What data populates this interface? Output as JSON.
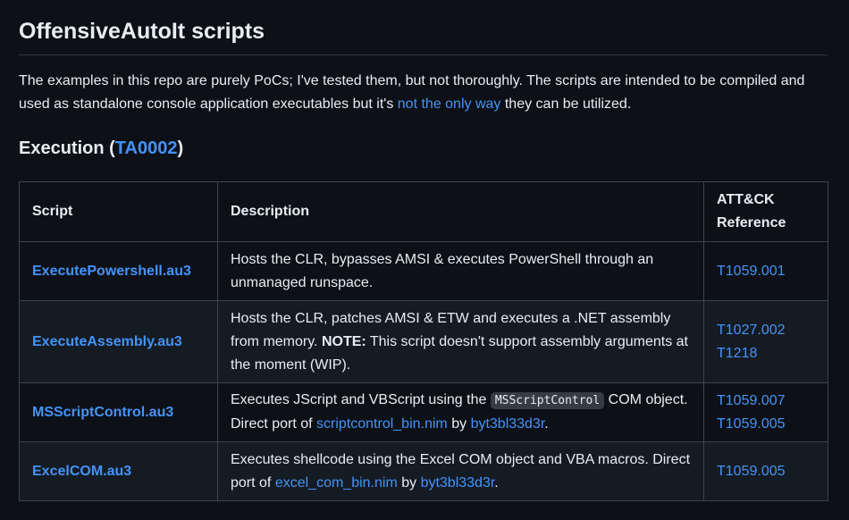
{
  "header": {
    "title": "OffensiveAutoIt scripts"
  },
  "intro": {
    "text_before": "The examples in this repo are purely PoCs; I've tested them, but not thoroughly. The scripts are intended to be compiled and used as standalone console application executables but it's ",
    "link": "not the only way",
    "text_after": " they can be utilized."
  },
  "section": {
    "title_prefix": "Execution (",
    "tactic_link": "TA0002",
    "title_suffix": ")"
  },
  "table": {
    "headers": [
      "Script",
      "Description",
      "ATT&CK Reference"
    ],
    "rows": [
      {
        "script": "ExecutePowershell.au3",
        "desc": {
          "text": "Hosts the CLR, bypasses AMSI & executes PowerShell through an unmanaged runspace."
        },
        "refs": [
          "T1059.001"
        ]
      },
      {
        "script": "ExecuteAssembly.au3",
        "desc": {
          "text_before": "Hosts the CLR, patches AMSI & ETW and executes a .NET assembly from memory. ",
          "bold": "NOTE:",
          "text_after": " This script doesn't support assembly arguments at the moment (WIP)."
        },
        "refs": [
          "T1027.002",
          "T1218"
        ]
      },
      {
        "script": "MSScriptControl.au3",
        "desc": {
          "text_before": "Executes JScript and VBScript using the ",
          "code": "MSScriptControl",
          "text_mid": " COM object. Direct port of ",
          "link1": "scriptcontrol_bin.nim",
          "by": " by ",
          "link2": "byt3bl33d3r",
          "end": "."
        },
        "refs": [
          "T1059.007",
          "T1059.005"
        ]
      },
      {
        "script": "ExcelCOM.au3",
        "desc": {
          "text_before": "Executes shellcode using the Excel COM object and VBA macros. Direct port of ",
          "link1": "excel_com_bin.nim",
          "by": " by ",
          "link2": "byt3bl33d3r",
          "end": "."
        },
        "refs": [
          "T1059.005"
        ]
      }
    ]
  },
  "colors": {
    "background": "#0d1117",
    "text": "#e6edf3",
    "link": "#4493f8",
    "border": "#3d444d",
    "alt_row": "#151b23"
  }
}
